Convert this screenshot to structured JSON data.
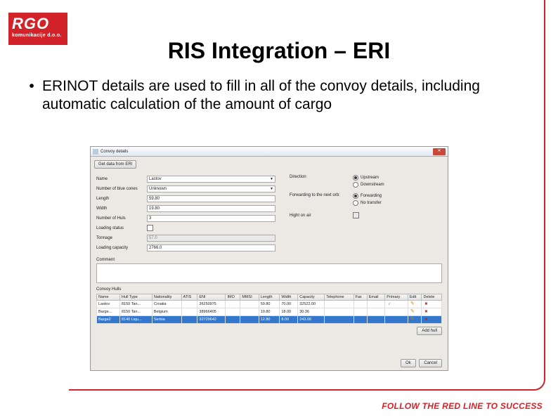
{
  "logo": {
    "big": "RGO",
    "small": "komunikacije d.o.o."
  },
  "title": "RIS Integration – ERI",
  "bullet": "ERINOT details are used to fill in all of the convoy details, including automatic calculation of the amount of cargo",
  "tagline": "FOLLOW THE RED LINE TO SUCCESS",
  "dialog": {
    "title": "Convoy details",
    "getdata_btn": "Get data from ERI",
    "left": {
      "name_label": "Name",
      "name_value": "Lastov",
      "bluecones_label": "Number of blue cones",
      "bluecones_value": "Unknown",
      "length_label": "Length",
      "length_value": "59.80",
      "width_label": "Width",
      "width_value": "19.80",
      "hulls_label": "Number of Huls",
      "hulls_value": "3",
      "loading_label": "Loading status",
      "tonnage_label": "Tonnage",
      "tonnage_value": "57.0",
      "capacity_label": "Loading capacity",
      "capacity_value": "2766.0"
    },
    "right": {
      "direction_label": "Direction",
      "dir_up": "Upstream",
      "dir_down": "Downstream",
      "forwarding_label": "Forwarding to the next orb:",
      "fwd_yes": "Forwarding",
      "fwd_no": "No transfer",
      "maxair_label": "Hight on air"
    },
    "comment_label": "Comment",
    "hulls_section": "Convoy Hulls",
    "table": {
      "headers": [
        "Name",
        "Hull Type",
        "Nationality",
        "ATIS",
        "ENI",
        "IMO",
        "MMSI",
        "Length",
        "Width",
        "Capacity",
        "Telephone",
        "Fax",
        "Email",
        "Primary",
        "Edit",
        "Delete"
      ],
      "rows": [
        [
          "Lastov",
          "8150 Tan...",
          "Croatia",
          "",
          "36250975",
          "",
          "",
          "59.80",
          "70.00",
          "32522.00",
          "",
          "",
          "",
          "check",
          "pencil",
          "x"
        ],
        [
          "Barge...",
          "8150 Tan...",
          "Belgium",
          "",
          "38966405",
          "",
          "",
          "19.80",
          "18.00",
          "30.36",
          "",
          "",
          "",
          "",
          "pencil",
          "x"
        ],
        [
          "Barge2",
          "8140 Liqu...",
          "Serbia",
          "",
          "32729642",
          "",
          "",
          "12.80",
          "8.00",
          "243.00",
          "",
          "",
          "",
          "",
          "pencil",
          "x"
        ]
      ]
    },
    "add_hull_btn": "Add hull",
    "ok_btn": "Ok",
    "cancel_btn": "Cancel"
  }
}
